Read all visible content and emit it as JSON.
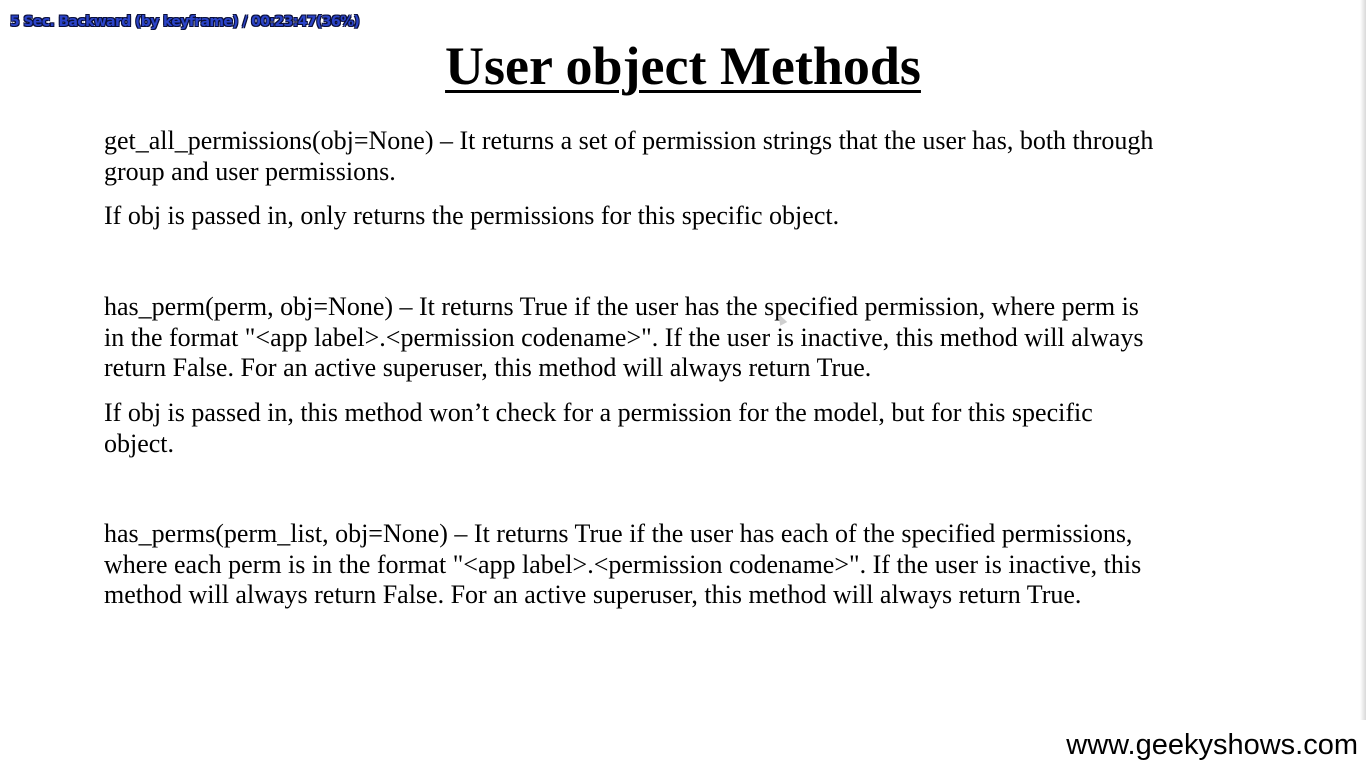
{
  "player": {
    "osd_text": "5 Sec. Backward (by keyframe) / 00:23:47(36%)"
  },
  "slide": {
    "title": "User object Methods",
    "paragraphs": [
      "get_all_permissions(obj=None) – It returns a set of permission strings that the user has, both through\ngroup and user permissions.",
      "If obj is passed in, only returns the permissions for this specific object.",
      "has_perm(perm, obj=None) – It returns True if the user has the specified permission, where perm is\nin the format \"<app label>.<permission codename>\". If the user is inactive, this method will always\nreturn False. For an active superuser, this method will always return True.",
      "If obj is passed in, this method won’t check for a permission for the model, but for this specific\nobject.",
      "has_perms(perm_list, obj=None) – It returns True if the user has each of the specified permissions,\nwhere each perm is in the format \"<app label>.<permission codename>\". If the user is inactive, this\nmethod will always return False. For an active superuser, this method will always return True."
    ],
    "website": "www.geekyshows.com"
  },
  "colors": {
    "osd_text": "#2b44c8",
    "osd_outline": "#0a0f3a",
    "background": "#ffffff",
    "text": "#000000"
  },
  "icons": {
    "cursor": "mouse-pointer-icon"
  }
}
